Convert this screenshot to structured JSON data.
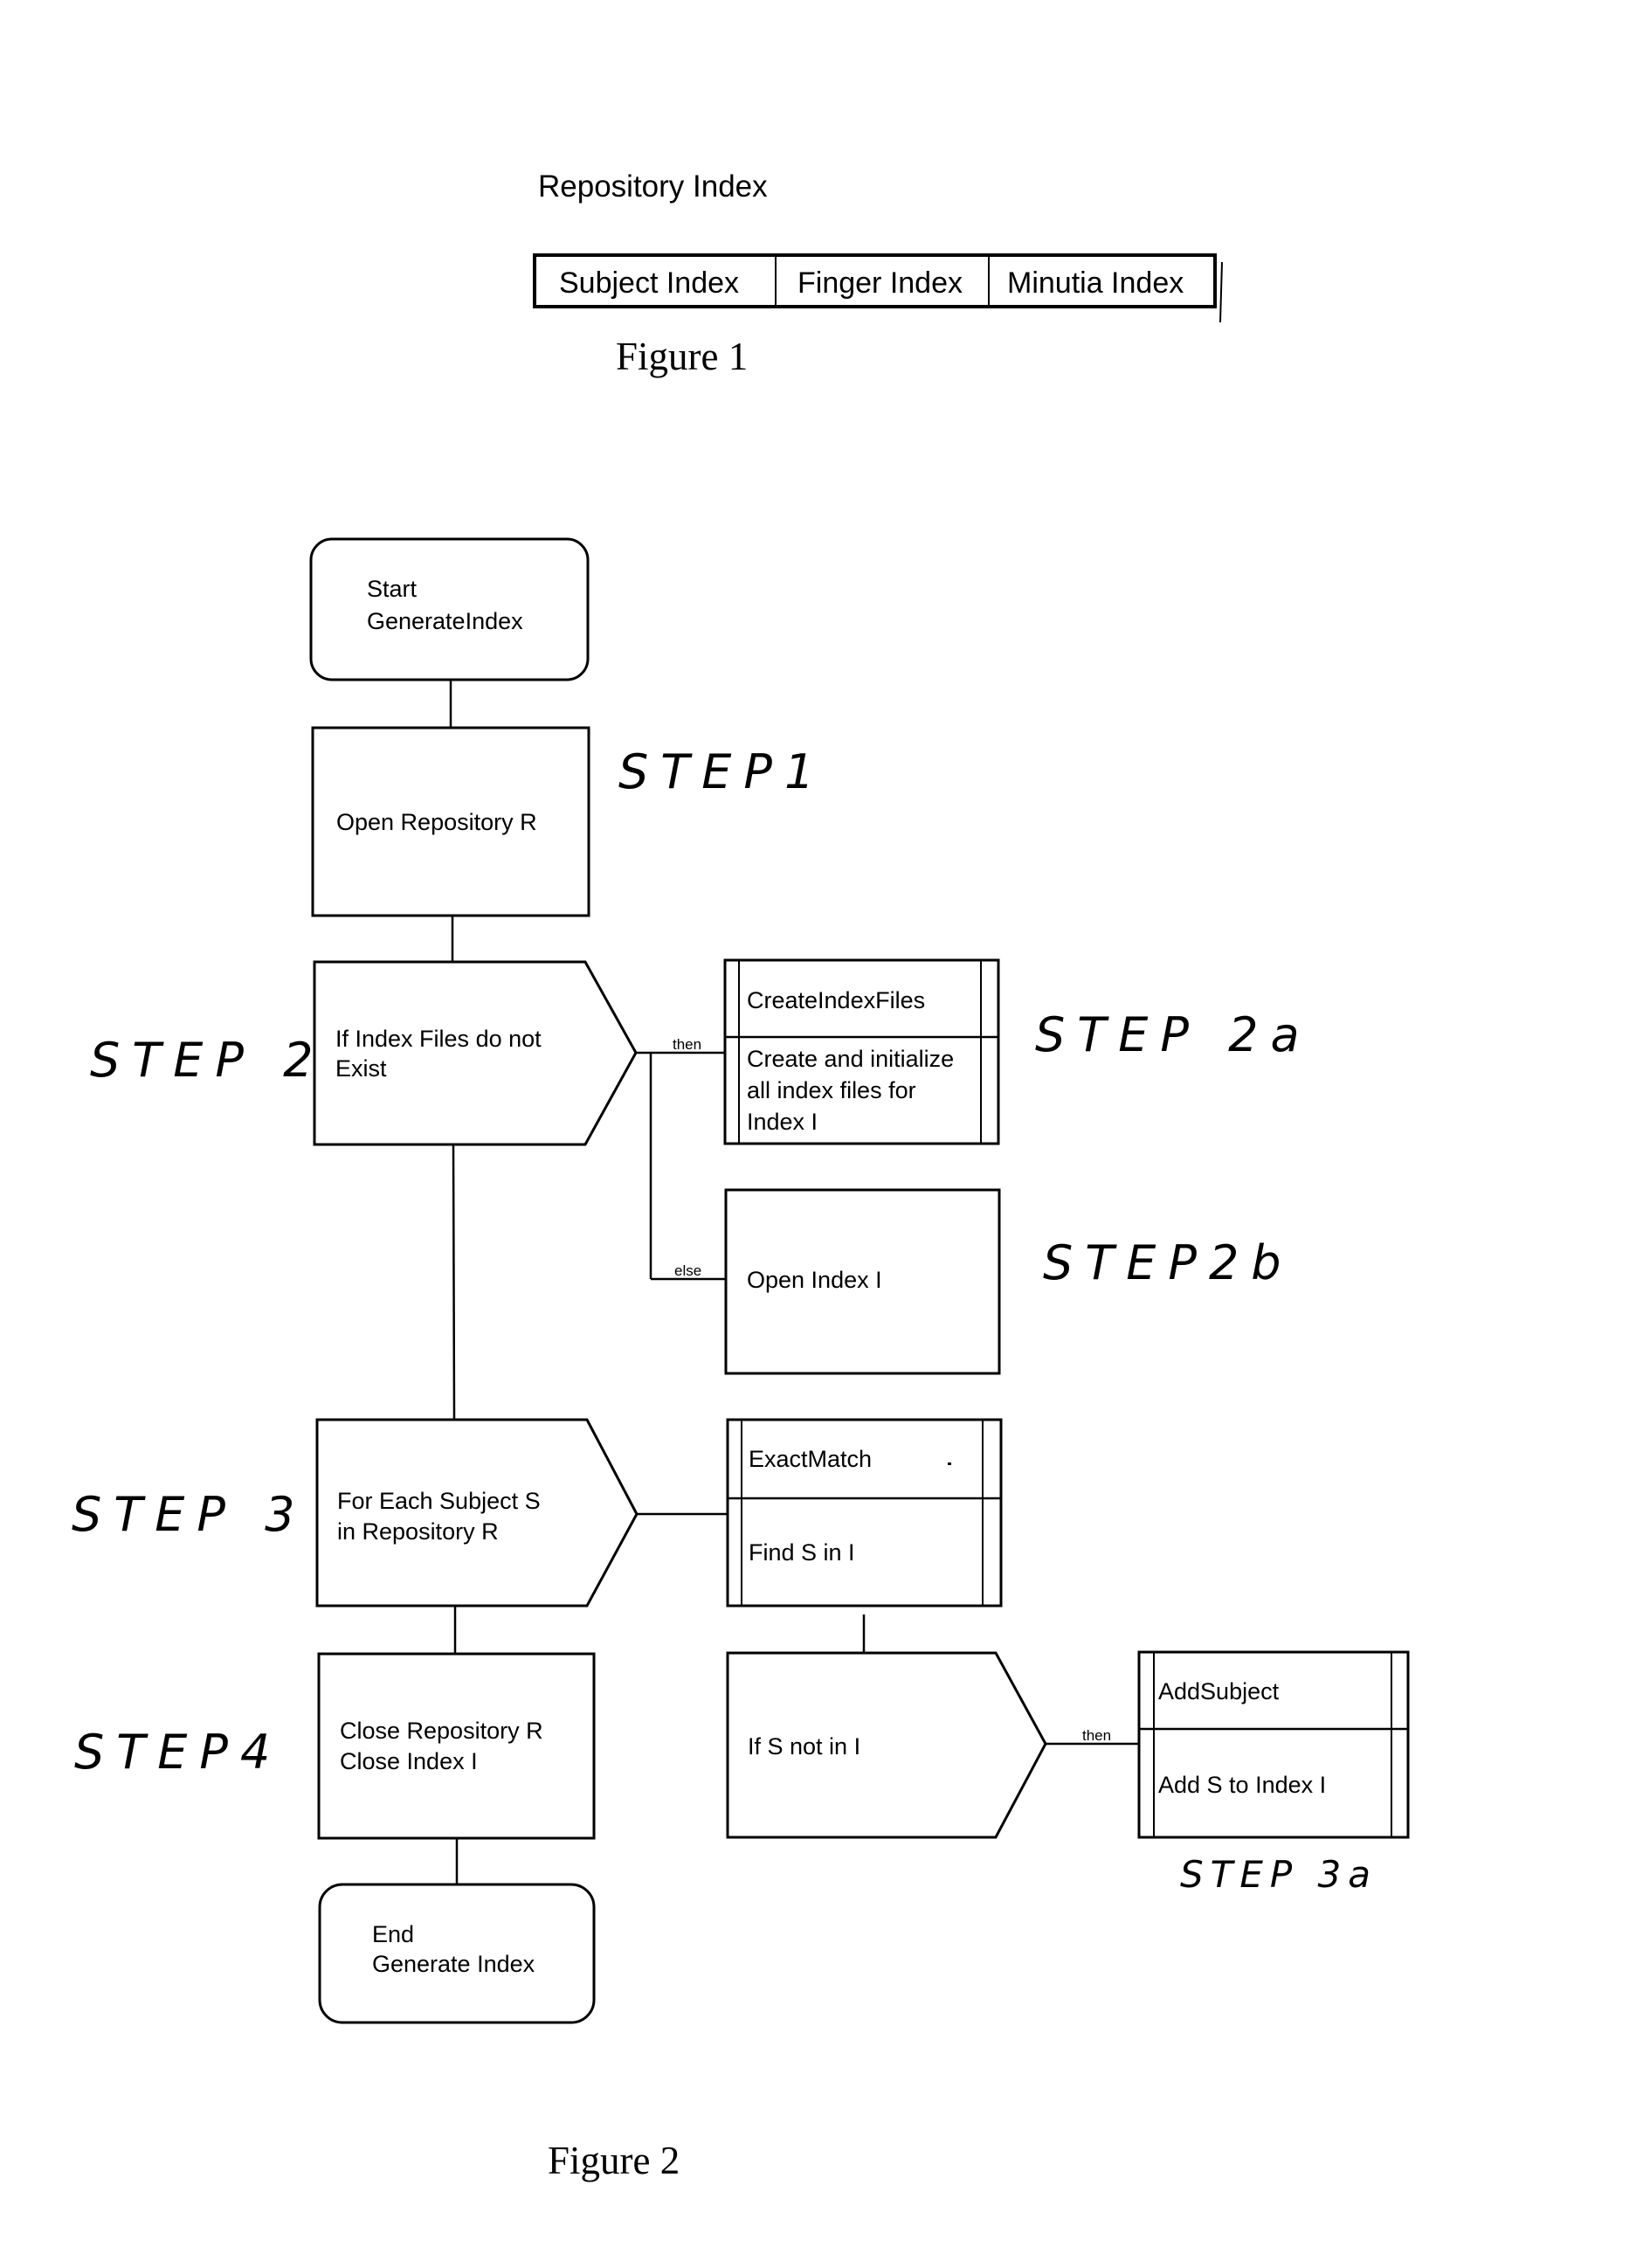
{
  "figure1": {
    "title": "Repository Index",
    "cells": [
      "Subject Index",
      "Finger Index",
      "Minutia Index"
    ],
    "caption": "Figure 1"
  },
  "figure2": {
    "caption": "Figure 2",
    "start": [
      "Start",
      "GenerateIndex"
    ],
    "open_repo": "Open Repository R",
    "if_index": [
      "If Index Files do not",
      "Exist"
    ],
    "create_files": {
      "title": "CreateIndexFiles",
      "body": [
        "Create and initialize",
        "all index files for",
        "Index I"
      ]
    },
    "open_index": "Open Index I",
    "for_each": [
      "For Each Subject S",
      "in Repository R"
    ],
    "exact_match": {
      "title": "ExactMatch",
      "body": "Find S in I"
    },
    "if_s": "If S not in I",
    "add_subject": {
      "title": "AddSubject",
      "body": "Add S to Index I"
    },
    "close": [
      "Close Repository R",
      "Close Index I"
    ],
    "end": [
      "End",
      "Generate Index"
    ],
    "labels": {
      "then1": "then",
      "else1": "else",
      "then2": "then"
    },
    "annotations": {
      "step1": "STEP1",
      "step2": "STEP 2",
      "step2a": "STEP 2a",
      "step2b": "STEP2b",
      "step3": "STEP 3",
      "step3a": "STEP 3a",
      "step4": "STEP4"
    }
  }
}
